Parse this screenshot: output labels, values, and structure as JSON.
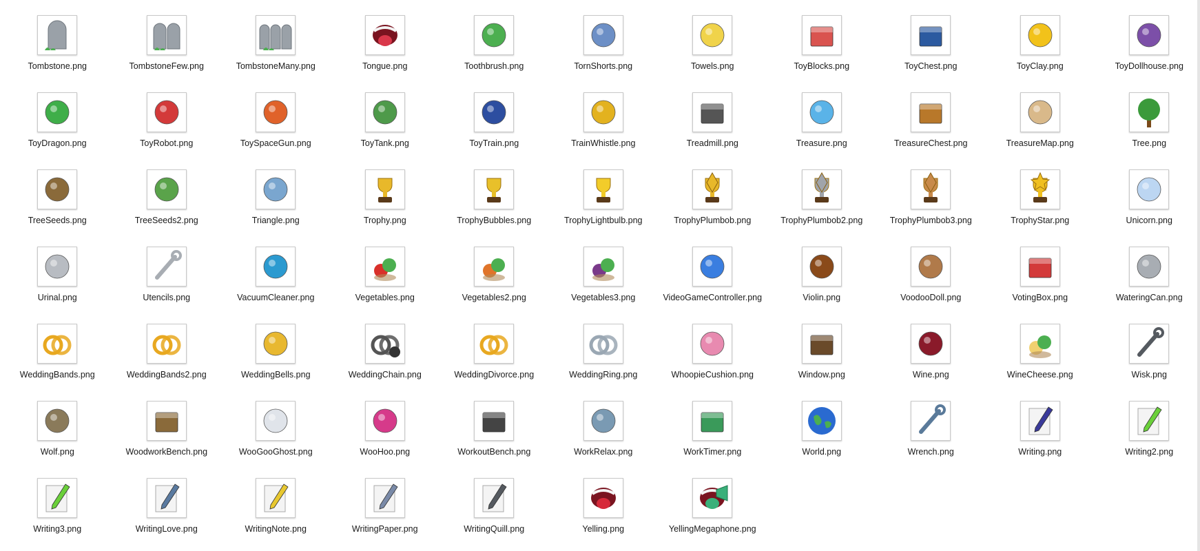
{
  "files": [
    {
      "name": "Tombstone.png",
      "icon": "tombstone-icon",
      "color": "#9aa1a8"
    },
    {
      "name": "TombstoneFew.png",
      "icon": "tombstone-few-icon",
      "color": "#9aa1a8"
    },
    {
      "name": "TombstoneMany.png",
      "icon": "tombstone-many-icon",
      "color": "#9aa1a8"
    },
    {
      "name": "Tongue.png",
      "icon": "tongue-icon",
      "color": "#d9374a"
    },
    {
      "name": "Toothbrush.png",
      "icon": "toothbrush-icon",
      "color": "#4caf50"
    },
    {
      "name": "TornShorts.png",
      "icon": "torn-shorts-icon",
      "color": "#6c8fc6"
    },
    {
      "name": "Towels.png",
      "icon": "towels-icon",
      "color": "#f0d34a"
    },
    {
      "name": "ToyBlocks.png",
      "icon": "toy-blocks-icon",
      "color": "#d9534f"
    },
    {
      "name": "ToyChest.png",
      "icon": "toy-chest-icon",
      "color": "#2c5aa0"
    },
    {
      "name": "ToyClay.png",
      "icon": "toy-clay-icon",
      "color": "#f2c21a"
    },
    {
      "name": "ToyDollhouse.png",
      "icon": "toy-dollhouse-icon",
      "color": "#7c4fa8"
    },
    {
      "name": "ToyDragon.png",
      "icon": "toy-dragon-icon",
      "color": "#3fae49"
    },
    {
      "name": "ToyRobot.png",
      "icon": "toy-robot-icon",
      "color": "#d33a3a"
    },
    {
      "name": "ToySpaceGun.png",
      "icon": "toy-space-gun-icon",
      "color": "#e0622a"
    },
    {
      "name": "ToyTank.png",
      "icon": "toy-tank-icon",
      "color": "#4e9a4a"
    },
    {
      "name": "ToyTrain.png",
      "icon": "toy-train-icon",
      "color": "#2d4ea0"
    },
    {
      "name": "TrainWhistle.png",
      "icon": "train-whistle-icon",
      "color": "#e3b21f"
    },
    {
      "name": "Treadmill.png",
      "icon": "treadmill-icon",
      "color": "#555555"
    },
    {
      "name": "Treasure.png",
      "icon": "treasure-icon",
      "color": "#5ab3e8"
    },
    {
      "name": "TreasureChest.png",
      "icon": "treasure-chest-icon",
      "color": "#b8782a"
    },
    {
      "name": "TreasureMap.png",
      "icon": "treasure-map-icon",
      "color": "#d9b98a"
    },
    {
      "name": "Tree.png",
      "icon": "tree-icon",
      "color": "#3b9a3b"
    },
    {
      "name": "TreeSeeds.png",
      "icon": "tree-seeds-icon",
      "color": "#8a6a3a"
    },
    {
      "name": "TreeSeeds2.png",
      "icon": "tree-seeds2-icon",
      "color": "#5aa34a"
    },
    {
      "name": "Triangle.png",
      "icon": "triangle-icon",
      "color": "#7aa6cf"
    },
    {
      "name": "Trophy.png",
      "icon": "trophy-icon",
      "color": "#e8b82a"
    },
    {
      "name": "TrophyBubbles.png",
      "icon": "trophy-bubbles-icon",
      "color": "#e8c02a"
    },
    {
      "name": "TrophyLightbulb.png",
      "icon": "trophy-lightbulb-icon",
      "color": "#f2cc2a"
    },
    {
      "name": "TrophyPlumbob.png",
      "icon": "trophy-plumbob-icon",
      "color": "#e8b82a"
    },
    {
      "name": "TrophyPlumbob2.png",
      "icon": "trophy-plumbob2-icon",
      "color": "#a0a4aa"
    },
    {
      "name": "TrophyPlumbob3.png",
      "icon": "trophy-plumbob3-icon",
      "color": "#c88a4a"
    },
    {
      "name": "TrophyStar.png",
      "icon": "trophy-star-icon",
      "color": "#f0c020"
    },
    {
      "name": "Unicorn.png",
      "icon": "unicorn-icon",
      "color": "#bcd6f2"
    },
    {
      "name": "Urinal.png",
      "icon": "urinal-icon",
      "color": "#b8bcc2"
    },
    {
      "name": "Utencils.png",
      "icon": "utensils-icon",
      "color": "#a8adb3"
    },
    {
      "name": "VacuumCleaner.png",
      "icon": "vacuum-cleaner-icon",
      "color": "#2b9ad0"
    },
    {
      "name": "Vegetables.png",
      "icon": "vegetables-icon",
      "color": "#d9302a"
    },
    {
      "name": "Vegetables2.png",
      "icon": "vegetables2-icon",
      "color": "#e0742a"
    },
    {
      "name": "Vegetables3.png",
      "icon": "vegetables3-icon",
      "color": "#7a3a8a"
    },
    {
      "name": "VideoGameController.png",
      "icon": "video-game-controller-icon",
      "color": "#3a7ee0"
    },
    {
      "name": "Violin.png",
      "icon": "violin-icon",
      "color": "#8a4a1a"
    },
    {
      "name": "VoodooDoll.png",
      "icon": "voodoo-doll-icon",
      "color": "#b07a4a"
    },
    {
      "name": "VotingBox.png",
      "icon": "voting-box-icon",
      "color": "#d33a3a"
    },
    {
      "name": "WateringCan.png",
      "icon": "watering-can-icon",
      "color": "#a8adb3"
    },
    {
      "name": "WeddingBands.png",
      "icon": "wedding-bands-icon",
      "color": "#e8a820"
    },
    {
      "name": "WeddingBands2.png",
      "icon": "wedding-bands2-icon",
      "color": "#e8a820"
    },
    {
      "name": "WeddingBells.png",
      "icon": "wedding-bells-icon",
      "color": "#e8b830"
    },
    {
      "name": "WeddingChain.png",
      "icon": "wedding-chain-icon",
      "color": "#555555"
    },
    {
      "name": "WeddingDivorce.png",
      "icon": "wedding-divorce-icon",
      "color": "#e8a820"
    },
    {
      "name": "WeddingRing.png",
      "icon": "wedding-ring-icon",
      "color": "#9aa7b3"
    },
    {
      "name": "WhoopieCushion.png",
      "icon": "whoopie-cushion-icon",
      "color": "#e88ab0"
    },
    {
      "name": "Window.png",
      "icon": "window-icon",
      "color": "#6a4a2a"
    },
    {
      "name": "Wine.png",
      "icon": "wine-icon",
      "color": "#8a1a2a"
    },
    {
      "name": "WineCheese.png",
      "icon": "wine-cheese-icon",
      "color": "#f0d070"
    },
    {
      "name": "Wisk.png",
      "icon": "whisk-icon",
      "color": "#555a60"
    },
    {
      "name": "Wolf.png",
      "icon": "wolf-icon",
      "color": "#8a7a5a"
    },
    {
      "name": "WoodworkBench.png",
      "icon": "woodwork-bench-icon",
      "color": "#8a6a3a"
    },
    {
      "name": "WooGooGhost.png",
      "icon": "woo-goo-ghost-icon",
      "color": "#e0e4ea"
    },
    {
      "name": "WooHoo.png",
      "icon": "woohoo-icon",
      "color": "#d63a8a"
    },
    {
      "name": "WorkoutBench.png",
      "icon": "workout-bench-icon",
      "color": "#444444"
    },
    {
      "name": "WorkRelax.png",
      "icon": "work-relax-icon",
      "color": "#7a9ab3"
    },
    {
      "name": "WorkTimer.png",
      "icon": "work-timer-icon",
      "color": "#3a9a5a"
    },
    {
      "name": "World.png",
      "icon": "world-icon",
      "color": "#2a6ad0"
    },
    {
      "name": "Wrench.png",
      "icon": "wrench-icon",
      "color": "#5a7a9a"
    },
    {
      "name": "Writing.png",
      "icon": "writing-icon",
      "color": "#3a3a9a"
    },
    {
      "name": "Writing2.png",
      "icon": "writing2-icon",
      "color": "#6ad03a"
    },
    {
      "name": "Writing3.png",
      "icon": "writing3-icon",
      "color": "#6ad03a"
    },
    {
      "name": "WritingLove.png",
      "icon": "writing-love-icon",
      "color": "#5a7aa0"
    },
    {
      "name": "WritingNote.png",
      "icon": "writing-note-icon",
      "color": "#e8c830"
    },
    {
      "name": "WritingPaper.png",
      "icon": "writing-paper-icon",
      "color": "#7a8aa8"
    },
    {
      "name": "WritingQuill.png",
      "icon": "writing-quill-icon",
      "color": "#555a60"
    },
    {
      "name": "Yelling.png",
      "icon": "yelling-icon",
      "color": "#d62a3a"
    },
    {
      "name": "YellingMegaphone.png",
      "icon": "yelling-megaphone-icon",
      "color": "#3ab07a"
    }
  ]
}
